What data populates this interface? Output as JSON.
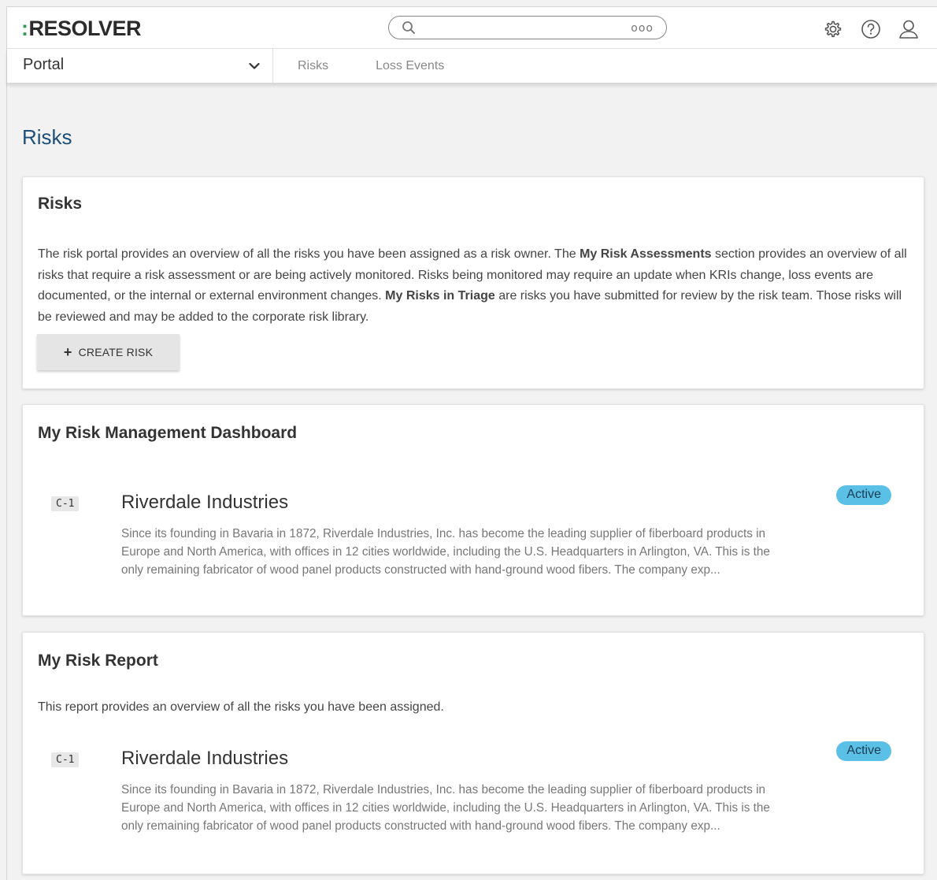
{
  "header": {
    "logo_colon": ":",
    "logo_text": "RESOLVER",
    "search_dots": "ooo",
    "icons": [
      "gear-icon",
      "help-icon",
      "user-icon"
    ]
  },
  "nav": {
    "portal_label": "Portal",
    "links": [
      "Risks",
      "Loss Events"
    ]
  },
  "page": {
    "title": "Risks"
  },
  "risks_card": {
    "heading": "Risks",
    "desc_1": "The risk portal provides an overview of all the risks you have been assigned as a risk owner. The ",
    "desc_bold_1": "My Risk Assessments",
    "desc_2": " section provides an overview of all risks that require a risk assessment or are being actively monitored. Risks being monitored may require an update when KRIs change, loss events are documented, or the internal or external environment changes. ",
    "desc_bold_2": "My Risks in Triage",
    "desc_3": " are risks you have submitted for review by the risk team. Those risks will be reviewed and may be added to the corporate risk library.",
    "create_label": "CREATE RISK"
  },
  "dashboard_card": {
    "heading": "My Risk Management Dashboard",
    "item": {
      "id": "C-1",
      "title": "Riverdale Industries",
      "description": "Since its founding in Bavaria in 1872, Riverdale Industries, Inc. has become the leading supplier of fiberboard products in Europe and North America, with offices in 12 cities worldwide, including the U.S. Headquarters in Arlington, VA. This is the only remaining fabricator of wood panel products constructed with hand-ground wood fibers. The company exp...",
      "status": "Active"
    }
  },
  "report_card": {
    "heading": "My Risk Report",
    "description": "This report provides an overview of all the risks you have been assigned.",
    "item": {
      "id": "C-1",
      "title": "Riverdale Industries",
      "description": "Since its founding in Bavaria in 1872, Riverdale Industries, Inc. has become the leading supplier of fiberboard products in Europe and North America, with offices in 12 cities worldwide, including the U.S. Headquarters in Arlington, VA. This is the only remaining fabricator of wood panel products constructed with hand-ground wood fibers. The company exp...",
      "status": "Active"
    }
  },
  "colors": {
    "title_blue": "#1d4f7a",
    "logo_green": "#2a9d4a",
    "status_blue": "#5bc0e6"
  }
}
